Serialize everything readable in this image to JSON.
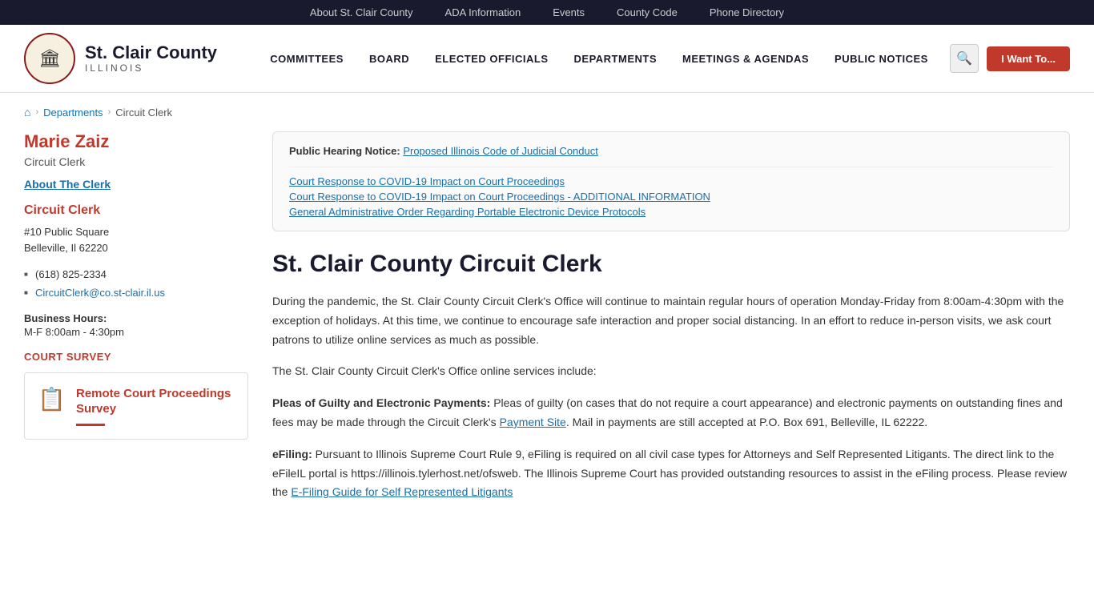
{
  "topbar": {
    "links": [
      {
        "id": "about-st-clair",
        "label": "About St. Clair County"
      },
      {
        "id": "ada-information",
        "label": "ADA Information"
      },
      {
        "id": "events",
        "label": "Events"
      },
      {
        "id": "county-code",
        "label": "County Code"
      },
      {
        "id": "phone-directory",
        "label": "Phone Directory"
      }
    ]
  },
  "header": {
    "logo_emoji": "🏛",
    "org_name_line1": "St. Clair County",
    "org_name_line2": "ILLINOIS",
    "nav_items": [
      {
        "id": "committees",
        "label": "COMMITTEES"
      },
      {
        "id": "board",
        "label": "BOARD"
      },
      {
        "id": "elected-officials",
        "label": "ELECTED OFFICIALS"
      },
      {
        "id": "departments",
        "label": "DEPARTMENTS"
      },
      {
        "id": "meetings-agendas",
        "label": "MEETINGS & AGENDAS"
      },
      {
        "id": "public-notices",
        "label": "PUBLIC NOTICES"
      }
    ],
    "search_icon": "🔍",
    "i_want_to_label": "I Want To..."
  },
  "breadcrumb": {
    "home_icon": "⌂",
    "items": [
      {
        "label": "Departments",
        "href": "#"
      },
      {
        "label": "Circuit Clerk",
        "href": "#"
      }
    ]
  },
  "sidebar": {
    "person_name": "Marie Zaiz",
    "person_title": "Circuit Clerk",
    "about_link": "About The Clerk",
    "section_title": "Circuit Clerk",
    "address_line1": "#10 Public Square",
    "address_line2": "Belleville, Il 62220",
    "phone": "(618) 825-2334",
    "email": "CircuitClerk@co.st-clair.il.us",
    "hours_label": "Business Hours:",
    "hours_value": "M-F  8:00am - 4:30pm",
    "court_survey_label": "COURT SURVEY",
    "survey_card": {
      "icon": "📋",
      "title": "Remote Court Proceedings Survey"
    }
  },
  "notice": {
    "label": "Public Hearing Notice:",
    "link_text": "Proposed Illinois Code of Judicial Conduct",
    "items": [
      "Court Response to COVID-19 Impact on Court Proceedings",
      "Court Response to COVID-19 Impact on Court Proceedings - ADDITIONAL INFORMATION",
      "General Administrative Order Regarding Portable Electronic Device Protocols"
    ]
  },
  "main": {
    "page_title": "St. Clair County Circuit Clerk",
    "paragraph1": "During the pandemic, the St. Clair County Circuit Clerk's Office will continue to maintain regular hours of operation Monday-Friday from 8:00am-4:30pm with the exception of holidays. At this time, we continue to encourage safe interaction and proper social distancing. In an effort to reduce in-person visits, we ask court patrons to utilize online services as much as possible.",
    "paragraph2": "The St. Clair County Circuit Clerk's Office online services include:",
    "paragraph3_label": "Pleas of Guilty and Electronic Payments:",
    "paragraph3_text": " Pleas of guilty (on cases that do not require a court appearance) and electronic payments on outstanding fines and fees may be made through the Circuit Clerk's ",
    "payment_site_link": "Payment Site",
    "paragraph3_tail": ". Mail in payments are still accepted at P.O. Box 691, Belleville, IL 62222.",
    "paragraph4_label": "eFiling:",
    "paragraph4_text": " Pursuant to Illinois Supreme Court Rule 9, eFiling is required on all civil case types for Attorneys and Self Represented Litigants. The direct link to the eFileIL portal is https://illinois.tylerhost.net/ofsweb. The Illinois Supreme Court has provided outstanding resources to assist in the eFiling process. Please review the ",
    "efiling_guide_link": "E-Filing Guide for Self Represented Litigants",
    "paragraph4_tail": ""
  },
  "colors": {
    "accent": "#c0392b",
    "link": "#1a6fa8",
    "dark": "#1a1a2e"
  }
}
